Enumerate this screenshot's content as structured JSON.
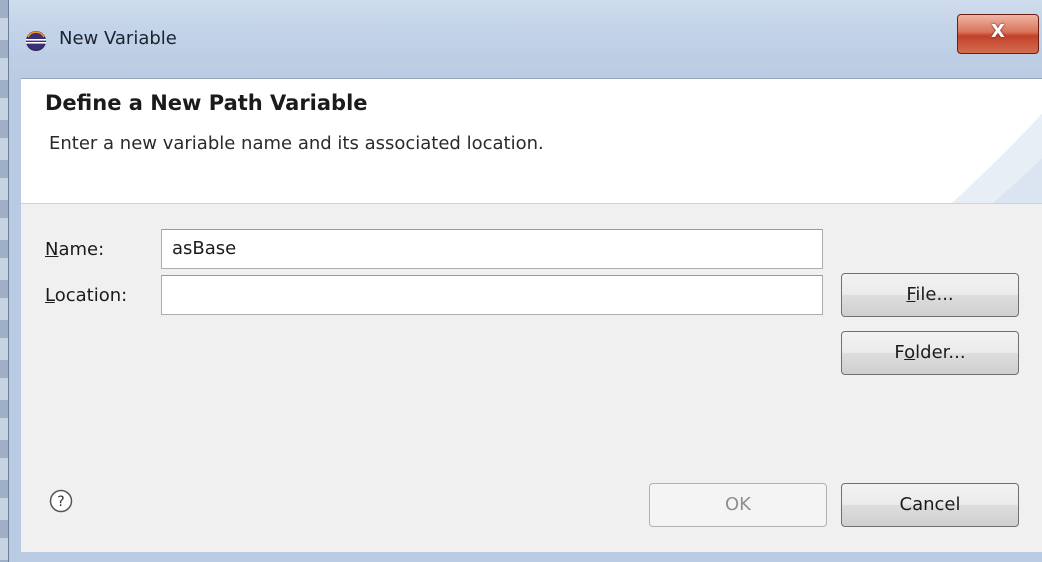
{
  "window": {
    "title": "New Variable",
    "close_label": "X"
  },
  "header": {
    "title": "Define a New Path Variable",
    "description": "Enter a new variable name and its associated location."
  },
  "form": {
    "name": {
      "label_pre": "",
      "label_mnemonic": "N",
      "label_post": "ame:",
      "value": "asBase"
    },
    "location": {
      "label_pre": "",
      "label_mnemonic": "L",
      "label_post": "ocation:",
      "value": ""
    }
  },
  "buttons": {
    "file": {
      "pre": "",
      "mnemonic": "F",
      "post": "ile..."
    },
    "folder": {
      "pre": "F",
      "mnemonic": "o",
      "post": "lder..."
    },
    "ok": "OK",
    "cancel": "Cancel"
  },
  "icons": {
    "app": "eclipse-icon",
    "help": "help-icon"
  },
  "colors": {
    "close_button": "#c2412a",
    "title_bar": "#c3d3e8",
    "dialog_background": "#f0f0f0"
  },
  "state": {
    "ok_enabled": false
  }
}
